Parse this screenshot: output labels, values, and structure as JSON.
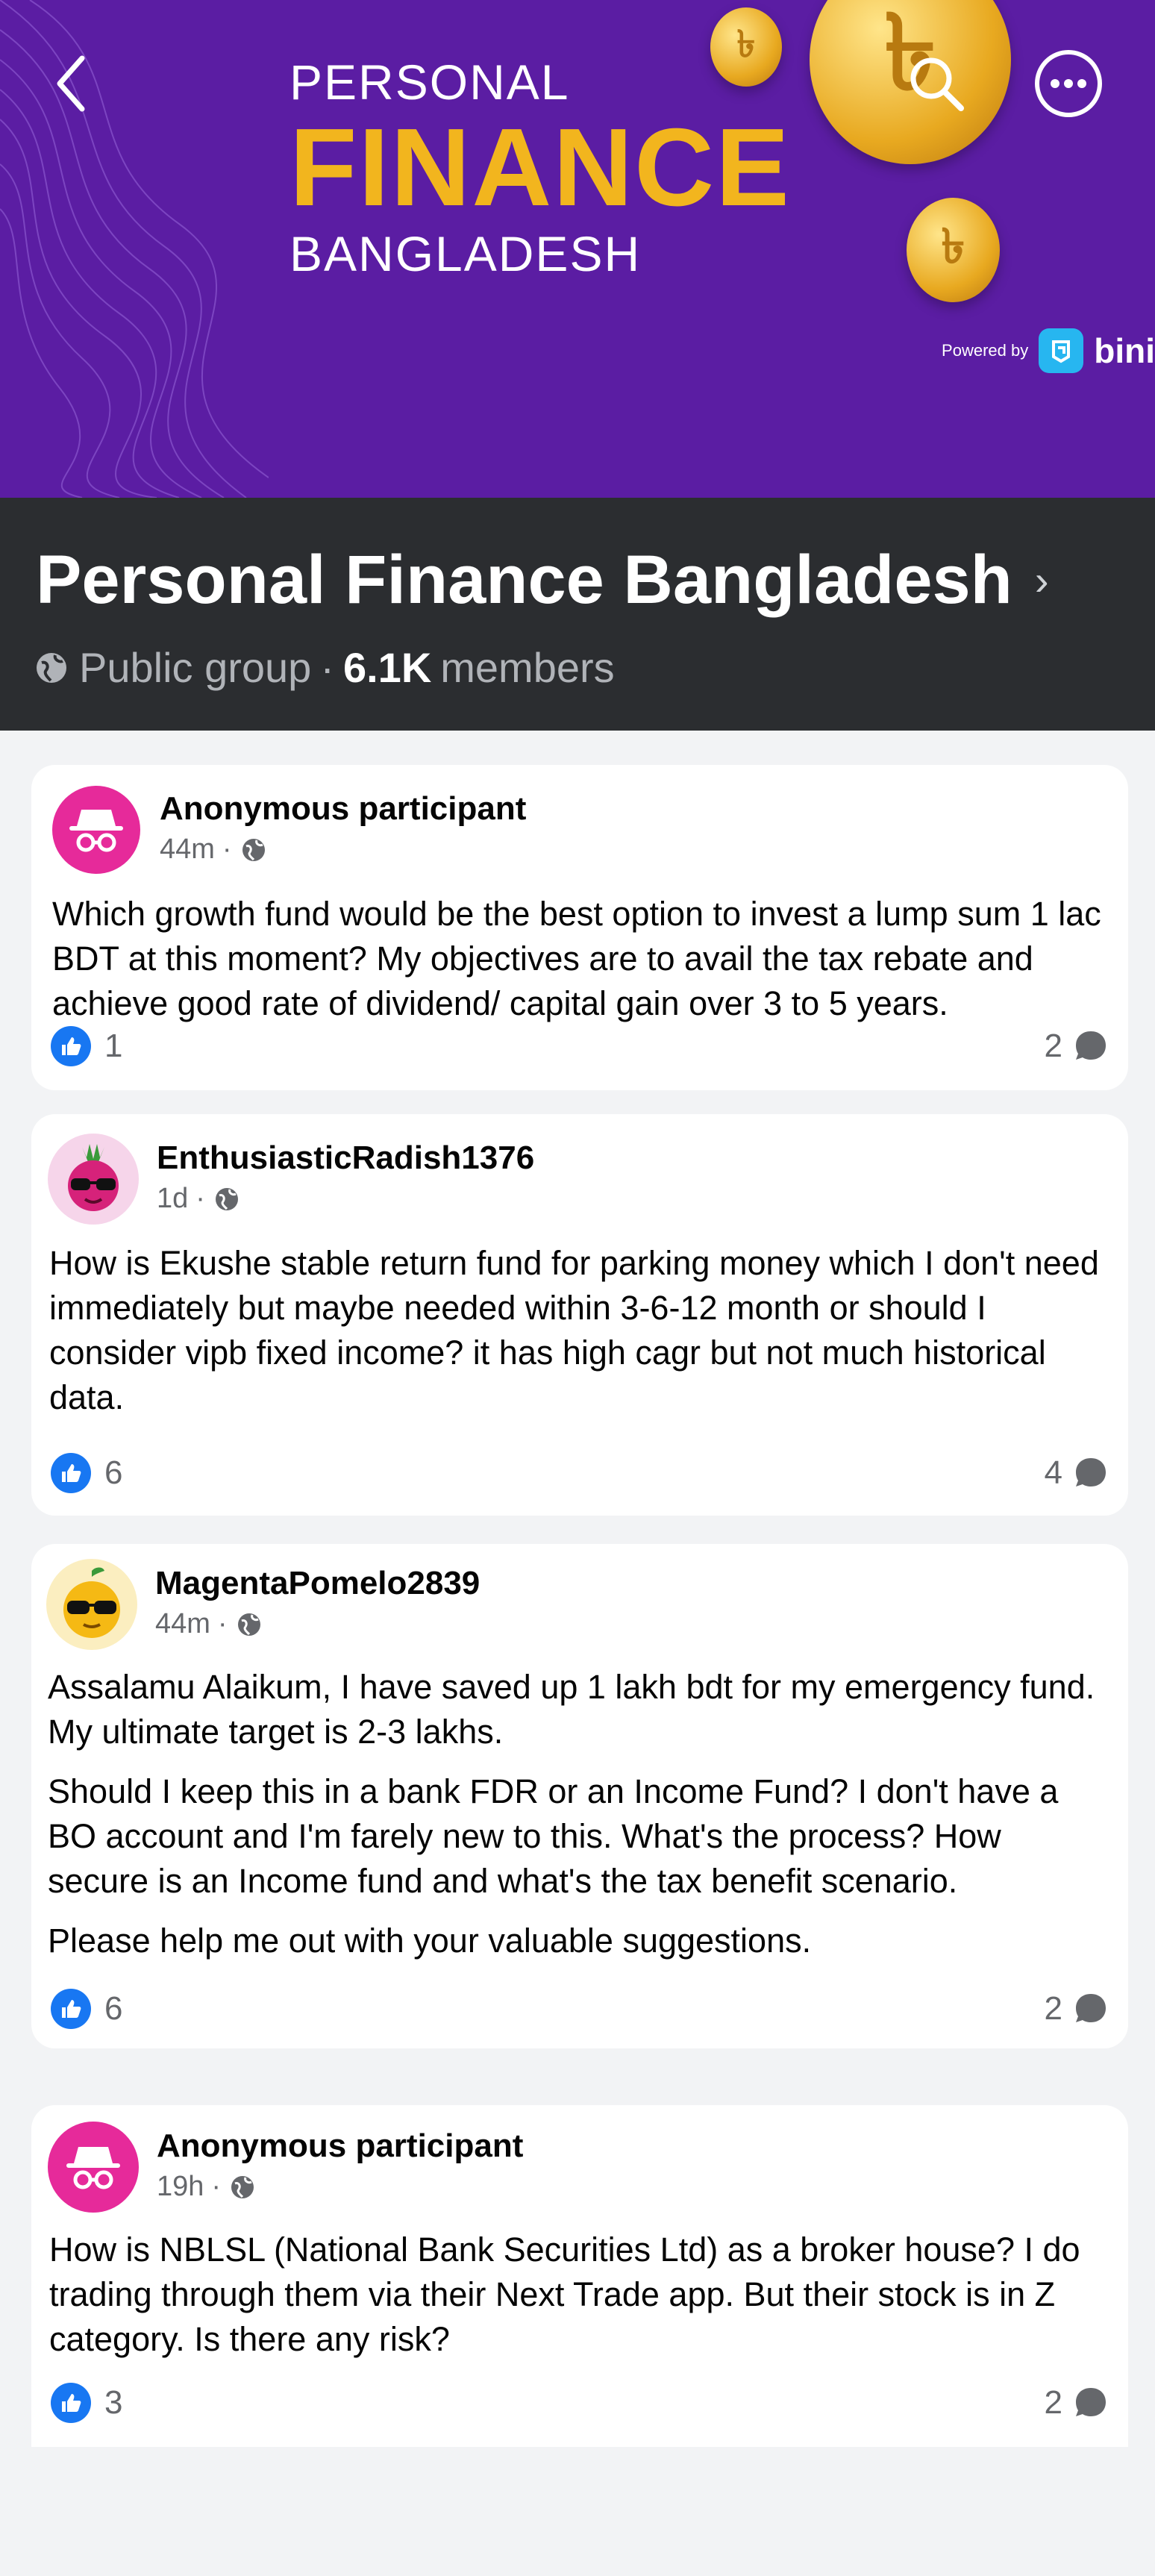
{
  "cover": {
    "line1": "PERSONAL",
    "line2": "FINANCE",
    "line3": "BANGLADESH",
    "powered_by": "Powered by",
    "brand": "bini",
    "coin_symbol": "৳"
  },
  "icons": {
    "back": "chevron-left-icon",
    "search": "search-icon",
    "more": "more-icon",
    "globe": "globe-icon",
    "like": "like-icon",
    "comment": "comment-icon"
  },
  "group": {
    "name": "Personal Finance Bangladesh",
    "chevron": "›",
    "privacy": "Public group",
    "separator": "·",
    "member_count": "6.1K",
    "members_label": "members"
  },
  "posts": [
    {
      "author": "Anonymous participant",
      "time": "44m",
      "dot": "·",
      "paragraphs": [
        "Which growth fund would be the best option to invest a lump sum  1 lac BDT at this moment? My objectives are to avail the tax rebate and achieve good rate of dividend/ capital gain over 3 to 5 years."
      ],
      "likes": "1",
      "comments": "2"
    },
    {
      "author": "EnthusiasticRadish1376",
      "time": "1d",
      "dot": "·",
      "paragraphs": [
        "How is Ekushe stable return fund for parking money which I don't need immediately but maybe needed within 3-6-12 month or should I consider vipb fixed income? it has high cagr but not much historical data."
      ],
      "likes": "6",
      "comments": "4"
    },
    {
      "author": "MagentaPomelo2839",
      "time": "44m",
      "dot": "·",
      "paragraphs": [
        "Assalamu Alaikum, I have saved up 1 lakh bdt for my emergency fund. My ultimate target is 2-3 lakhs.",
        "Should I keep this in a bank FDR or an Income Fund?  I don't have a BO account and I'm farely new to this. What's the process? How secure is an Income fund and what's the tax benefit scenario.",
        "Please help me out with your valuable suggestions."
      ],
      "likes": "6",
      "comments": "2"
    },
    {
      "author": "Anonymous participant",
      "time": "19h",
      "dot": "·",
      "paragraphs": [
        "How is NBLSL (National Bank Securities Ltd) as a broker house? I do trading through them via their Next Trade app. But their stock is in Z category. Is there any risk?"
      ],
      "likes": "3",
      "comments": "2"
    }
  ],
  "colors": {
    "cover_bg": "#5b1da3",
    "gold": "#f2b51e",
    "header_bg": "#2b2d30",
    "like_blue": "#1877f2",
    "anon_pink": "#e62a9a"
  }
}
